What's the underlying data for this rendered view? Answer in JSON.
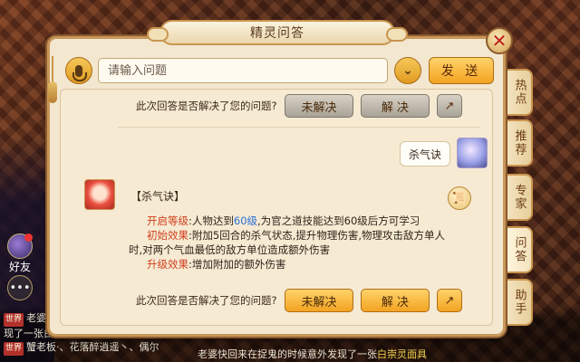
{
  "window": {
    "title": "精灵问答"
  },
  "input": {
    "placeholder": "请输入问题",
    "send_label": "发 送"
  },
  "side_tabs": [
    "热点",
    "推荐",
    "专家",
    "问答",
    "助手"
  ],
  "feedback": {
    "question": "此次回答是否解决了您的问题?",
    "unsolved": "未解决",
    "solved": "解 决"
  },
  "user_message": "杀气诀",
  "answer": {
    "title": "【杀气诀】",
    "open_level_label": "开启等级",
    "open_level_text_a": ":人物达到",
    "open_level_value": "60级",
    "open_level_text_b": ",为官之道技能达到60级后方可学习",
    "init_effect_label": "初始效果",
    "init_effect_text": ":附加5回合的杀气状态,提升物理伤害,物理攻击敌方单人",
    "init_effect_text2": "时,对两个气血最低的敌方单位造成额外伤害",
    "upgrade_label": "升级效果",
    "upgrade_text": ":增加附加的额外伤害"
  },
  "game_ui": {
    "friend_label": "好友",
    "chat_lines": [
      {
        "tag": "世界",
        "text": "老婆"
      },
      {
        "tag": "",
        "text": "现了一张白"
      },
      {
        "tag": "世界",
        "text": "蟹老板·、花落醉逍遥丶、偶尔"
      }
    ],
    "bottom_text_a": "老婆快回来在捉鬼的时候意外发现了一张",
    "bottom_text_b": "白崇灵面具"
  },
  "colors": {
    "accent": "#f3a321",
    "label_red": "#d0401e",
    "highlight_blue": "#2b6fd6"
  }
}
